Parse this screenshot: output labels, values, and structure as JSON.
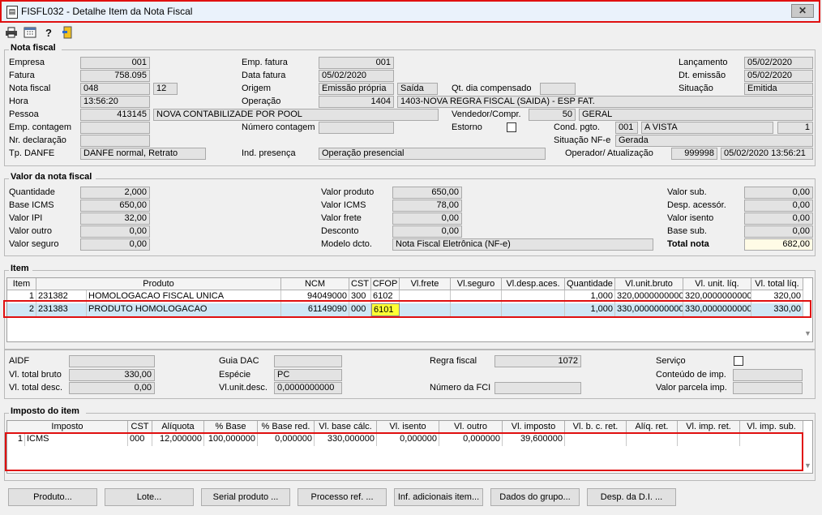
{
  "window": {
    "title": "FISFL032 - Detalhe Item da Nota Fiscal",
    "close_glyph": "✕"
  },
  "toolbar": {
    "icons": [
      "printer-icon",
      "calendar-icon",
      "help-icon",
      "exit-icon"
    ]
  },
  "nota_fiscal": {
    "title": "Nota fiscal",
    "labels": {
      "empresa": "Empresa",
      "fatura": "Fatura",
      "nota_fiscal": "Nota fiscal",
      "hora": "Hora",
      "pessoa": "Pessoa",
      "emp_contagem": "Emp. contagem",
      "nr_declaracao": "Nr. declaração",
      "tp_danfe": "Tp. DANFE",
      "emp_fatura": "Emp. fatura",
      "data_fatura": "Data fatura",
      "origem": "Origem",
      "operacao": "Operação",
      "numero_contagem": "Número contagem",
      "ind_presenca": "Ind. presença",
      "qt_dia_compensado": "Qt. dia compensado",
      "vendedor": "Vendedor/Compr.",
      "estorno": "Estorno",
      "cond_pgto": "Cond. pgto.",
      "situacao_nfe": "Situação NF-e",
      "operador": "Operador/ Atualização",
      "lancamento": "Lançamento",
      "dt_emissao": "Dt. emissão",
      "situacao": "Situação"
    },
    "values": {
      "empresa": "001",
      "fatura": "758.095",
      "nota_fiscal": "048",
      "serie": "12",
      "hora": "13:56:20",
      "pessoa_cod": "413145",
      "pessoa_nome": "NOVA CONTABILIZADE POR POOL",
      "emp_contagem": "",
      "nr_declaracao": "",
      "tp_danfe": "DANFE normal, Retrato",
      "emp_fatura": "001",
      "data_fatura": "05/02/2020",
      "origem": "Emissão própria",
      "origem_tipo": "Saída",
      "operacao_cod": "1404",
      "operacao_desc": "1403-NOVA REGRA FISCAL (SAIDA) - ESP FAT.",
      "numero_contagem": "",
      "ind_presenca": "Operação presencial",
      "qt_dia_compensado": "",
      "vendedor_cod": "50",
      "vendedor_nome": "GERAL",
      "cond_pgto_cod": "001",
      "cond_pgto_desc": "A VISTA",
      "cond_pgto_parc": "1",
      "situacao_nfe": "Gerada",
      "operador": "999998",
      "atualizacao": "05/02/2020 13:56:21",
      "lancamento": "05/02/2020",
      "dt_emissao": "05/02/2020",
      "situacao": "Emitida"
    }
  },
  "valor_nf": {
    "title": "Valor da nota fiscal",
    "labels": {
      "quantidade": "Quantidade",
      "base_icms": "Base ICMS",
      "valor_ipi": "Valor IPI",
      "valor_outro": "Valor outro",
      "valor_seguro": "Valor seguro",
      "valor_produto": "Valor produto",
      "valor_icms": "Valor ICMS",
      "valor_frete": "Valor frete",
      "desconto": "Desconto",
      "modelo_dcto": "Modelo dcto.",
      "valor_sub": "Valor sub.",
      "desp_acessor": "Desp. acessór.",
      "valor_isento": "Valor isento",
      "base_sub": "Base sub.",
      "total_nota": "Total nota"
    },
    "values": {
      "quantidade": "2,000",
      "base_icms": "650,00",
      "valor_ipi": "32,00",
      "valor_outro": "0,00",
      "valor_seguro": "0,00",
      "valor_produto": "650,00",
      "valor_icms": "78,00",
      "valor_frete": "0,00",
      "desconto": "0,00",
      "modelo_dcto": "Nota Fiscal Eletrônica (NF-e)",
      "valor_sub": "0,00",
      "desp_acessor": "0,00",
      "valor_isento": "0,00",
      "base_sub": "0,00",
      "total_nota": "682,00"
    }
  },
  "item": {
    "title": "Item",
    "columns": [
      "Item",
      "Produto",
      "NCM",
      "CST",
      "CFOP",
      "Vl.frete",
      "Vl.seguro",
      "Vl.desp.aces.",
      "Quantidade",
      "Vl.unit.bruto",
      "Vl. unit. líq.",
      "Vl. total líq."
    ],
    "rows": [
      [
        "1",
        "231382",
        "HOMOLOGACAO FISCAL UNICA",
        "94049000",
        "300",
        "6102",
        "",
        "",
        "",
        "1,000",
        "320,0000000000",
        "320,0000000000",
        "320,00"
      ],
      [
        "2",
        "231383",
        "PRODUTO HOMOLOGACAO",
        "61149090",
        "000",
        "6101",
        "",
        "",
        "",
        "1,000",
        "330,0000000000",
        "330,0000000000",
        "330,00"
      ]
    ]
  },
  "item_detail": {
    "labels": {
      "aidf": "AIDF",
      "vl_total_bruto": "Vl. total bruto",
      "vl_total_desc": "Vl. total desc.",
      "guia_dac": "Guia DAC",
      "especie": "Espécie",
      "vl_unit_desc": "Vl.unit.desc.",
      "regra_fiscal": "Regra fiscal",
      "numero_fci": "Número da FCI",
      "servico": "Serviço",
      "conteudo_imp": "Conteúdo de imp.",
      "valor_parcela_imp": "Valor parcela imp."
    },
    "values": {
      "aidf": "",
      "vl_total_bruto": "330,00",
      "vl_total_desc": "0,00",
      "guia_dac": "",
      "especie": "PC",
      "vl_unit_desc": "0,0000000000",
      "regra_fiscal": "1072",
      "numero_fci": "",
      "conteudo_imp": "",
      "valor_parcela_imp": ""
    }
  },
  "imposto": {
    "title": "Imposto do item",
    "columns": [
      "Imposto",
      "CST",
      "Alíquota",
      "% Base",
      "% Base red.",
      "Vl. base cálc.",
      "Vl. isento",
      "Vl. outro",
      "Vl. imposto",
      "Vl. b. c. ret.",
      "Alíq. ret.",
      "Vl. imp. ret.",
      "Vl. imp. sub."
    ],
    "rows": [
      [
        "1",
        "ICMS",
        "000",
        "12,000000",
        "100,000000",
        "0,000000",
        "330,000000",
        "0,000000",
        "0,000000",
        "39,600000",
        "",
        "",
        "",
        ""
      ]
    ]
  },
  "buttons": [
    "Produto...",
    "Lote...",
    "Serial produto ...",
    "Processo ref. ...",
    "Inf. adicionais item...",
    "Dados do grupo...",
    "Desp. da D.I. ..."
  ],
  "colors": {
    "highlight_red": "#e01010",
    "selected_row": "#cfe7f5",
    "cfop_highlight": "#ffff33",
    "total_field": "#fffbe6"
  }
}
